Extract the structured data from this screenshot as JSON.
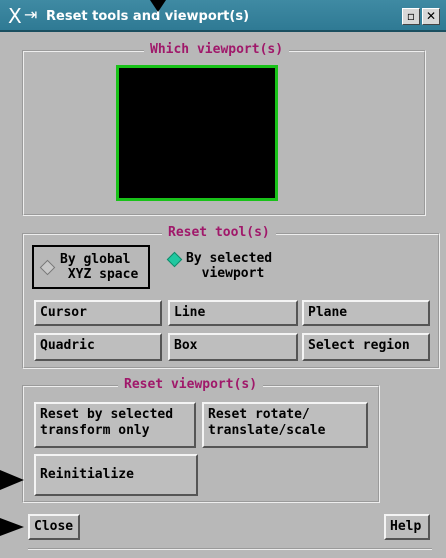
{
  "window": {
    "title": "Reset tools and viewport(s)",
    "buttons": {
      "iconify": "▫",
      "close": "✕"
    }
  },
  "viewport_section": {
    "title": "Which viewport(s)"
  },
  "tool_section": {
    "title": "Reset tool(s)",
    "radio_global": "By global\n XYZ space",
    "radio_selected": "By selected\n  viewport",
    "buttons": [
      "Cursor",
      "Line",
      "Plane",
      "Quadric",
      "Box",
      "Select region"
    ]
  },
  "viewport_reset_section": {
    "title": "Reset viewport(s)",
    "reset_selected": "Reset by selected\ntransform only",
    "reset_rts": "Reset rotate/\ntranslate/scale",
    "reinitialize": "Reinitialize"
  },
  "footer": {
    "close": "Close",
    "help": "Help"
  },
  "colors": {
    "title_bar": "#2f7a94",
    "section_title": "#a0186a",
    "viewport_border": "#19c219",
    "selected_radio": "#20c8a0"
  }
}
